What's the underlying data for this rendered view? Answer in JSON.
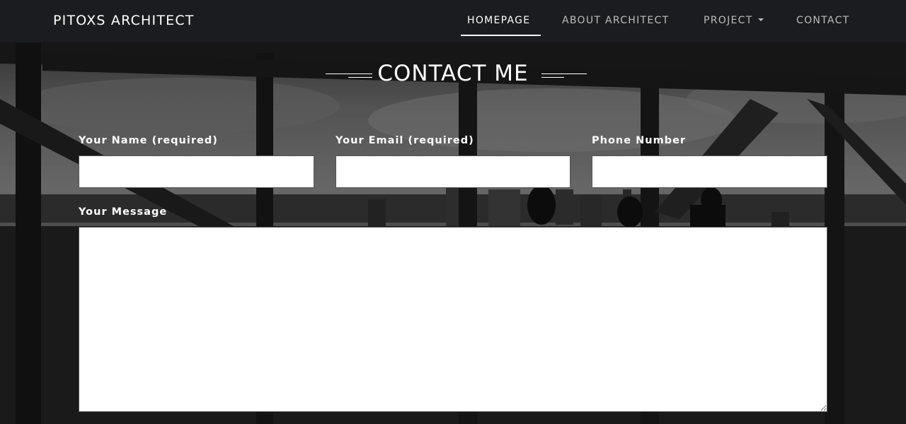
{
  "header": {
    "brand": "PITOXS ARCHITECT",
    "nav": [
      {
        "label": "HOMEPAGE",
        "active": true
      },
      {
        "label": "ABOUT ARCHITECT",
        "active": false
      },
      {
        "label": "PROJECT",
        "active": false,
        "has_dropdown": true
      },
      {
        "label": "CONTACT",
        "active": false
      }
    ]
  },
  "contact": {
    "title": "CONTACT ME",
    "fields": {
      "name_label": "Your Name (required)",
      "email_label": "Your Email (required)",
      "phone_label": "Phone Number",
      "message_label": "Your Message"
    },
    "values": {
      "name": "",
      "email": "",
      "phone": "",
      "message": ""
    }
  },
  "colors": {
    "navbar_bg": "#1b1c1f",
    "text_white": "#ffffff",
    "nav_inactive": "#bdbdbd",
    "input_bg": "#ffffff"
  }
}
